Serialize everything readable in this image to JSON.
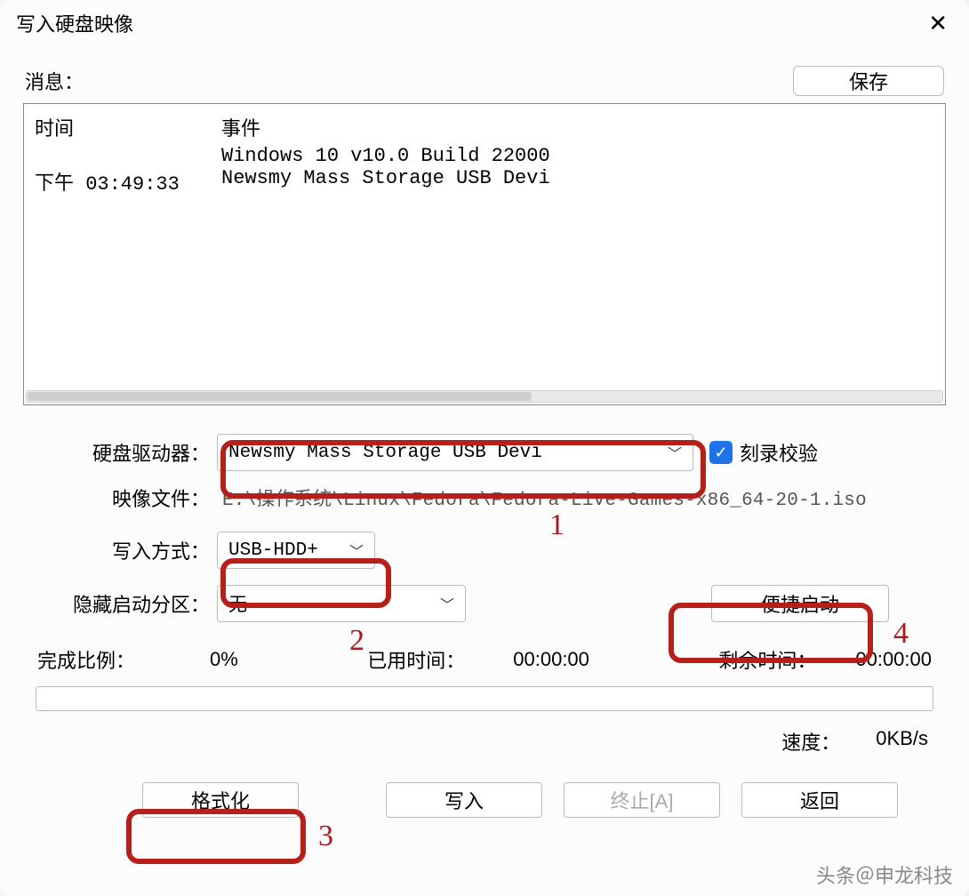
{
  "window": {
    "title": "写入硬盘映像"
  },
  "message_section": {
    "label": "消息：",
    "save_button": "保存"
  },
  "log": {
    "header_time": "时间",
    "header_event": "事件",
    "rows": [
      {
        "time": "",
        "event": "Windows 10 v10.0 Build 22000"
      },
      {
        "time": "下午 03:49:33",
        "event": "Newsmy Mass Storage USB Devi"
      }
    ]
  },
  "form": {
    "drive_label": "硬盘驱动器：",
    "drive_value": "Newsmy Mass Storage USB Devi",
    "verify_label": "刻录校验",
    "verify_checked": true,
    "image_label": "映像文件：",
    "image_value": "E:\\操作系统\\Linux\\Fedora\\Fedora-Live-Games-x86_64-20-1.iso",
    "write_method_label": "写入方式：",
    "write_method_value": "USB-HDD+",
    "hide_boot_label": "隐藏启动分区：",
    "hide_boot_value": "无",
    "quick_boot_button": "便捷启动"
  },
  "progress": {
    "done_label": "完成比例：",
    "done_value": "0%",
    "elapsed_label": "已用时间：",
    "elapsed_value": "00:00:00",
    "remain_label": "剩余时间：",
    "remain_value": "00:00:00",
    "speed_label": "速度：",
    "speed_value": "0KB/s"
  },
  "buttons": {
    "format": "格式化",
    "write": "写入",
    "stop": "终止[A]",
    "back": "返回"
  },
  "annotations": {
    "n1": "1",
    "n2": "2",
    "n3": "3",
    "n4": "4"
  },
  "watermark": "头条＠申龙科技"
}
